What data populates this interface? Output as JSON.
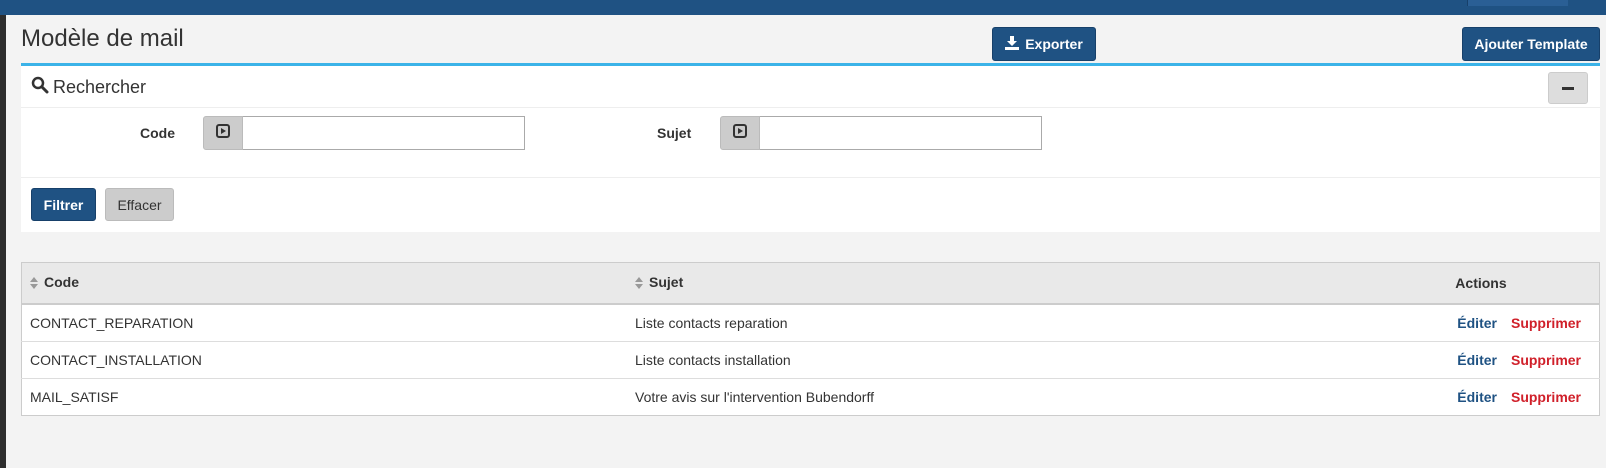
{
  "header": {
    "title": "Modèle de mail",
    "export_label": "Exporter",
    "add_label": "Ajouter Template"
  },
  "search": {
    "title": "Rechercher",
    "code_label": "Code",
    "code_value": "",
    "sujet_label": "Sujet",
    "sujet_value": "",
    "filter_label": "Filtrer",
    "clear_label": "Effacer"
  },
  "table": {
    "columns": [
      "Code",
      "Sujet",
      "Actions"
    ],
    "rows": [
      {
        "code": "CONTACT_REPARATION",
        "sujet": "Liste contacts reparation",
        "edit": "Éditer",
        "delete": "Supprimer"
      },
      {
        "code": "CONTACT_INSTALLATION",
        "sujet": "Liste contacts installation",
        "edit": "Éditer",
        "delete": "Supprimer"
      },
      {
        "code": "MAIL_SATISF",
        "sujet": "Votre avis sur l'intervention Bubendorff",
        "edit": "Éditer",
        "delete": "Supprimer"
      }
    ]
  },
  "icons": {
    "export": "download-icon",
    "search": "search-icon",
    "collapse": "minus-icon",
    "addon": "play-square-icon",
    "sort": "sort-icon"
  },
  "colors": {
    "primary": "#1f5283",
    "accent": "#3bb3e8",
    "danger": "#d0202a",
    "topbar": "#1f5283"
  }
}
